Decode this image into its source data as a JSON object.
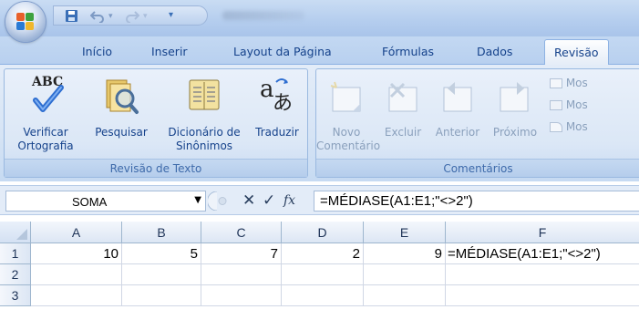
{
  "quick_access": {
    "save_icon": "save-icon",
    "undo_icon": "undo-icon",
    "redo_icon": "redo-icon"
  },
  "tabs": [
    {
      "label": "Início"
    },
    {
      "label": "Inserir"
    },
    {
      "label": "Layout da Página"
    },
    {
      "label": "Fórmulas"
    },
    {
      "label": "Dados"
    },
    {
      "label": "Revisão",
      "active": true
    }
  ],
  "ribbon": {
    "groups": [
      {
        "title": "Revisão de Texto",
        "buttons": [
          {
            "icon": "abc-spellcheck-icon",
            "label": "Verificar Ortografia"
          },
          {
            "icon": "research-book-icon",
            "label": "Pesquisar"
          },
          {
            "icon": "thesaurus-book-icon",
            "label": "Dicionário de Sinônimos"
          },
          {
            "icon": "translate-icon",
            "label": "Traduzir"
          }
        ]
      },
      {
        "title": "Comentários",
        "buttons": [
          {
            "icon": "new-comment-icon",
            "label": "Novo Comentário"
          },
          {
            "icon": "delete-comment-icon",
            "label": "Excluir"
          },
          {
            "icon": "previous-comment-icon",
            "label": "Anterior"
          },
          {
            "icon": "next-comment-icon",
            "label": "Próximo"
          }
        ],
        "small_buttons": [
          "Mos",
          "Mos",
          "Mos"
        ]
      }
    ]
  },
  "formula_bar": {
    "name_box": "SOMA",
    "fx_label": "fx",
    "formula": "=MÉDIASE(A1:E1;\"<>2\")"
  },
  "grid": {
    "columns": [
      "A",
      "B",
      "C",
      "D",
      "E",
      "F"
    ],
    "rows": [
      "1",
      "2",
      "3"
    ],
    "row1": [
      "10",
      "5",
      "7",
      "2",
      "9",
      "=MÉDIASE(A1:E1;\"<>2\")"
    ]
  },
  "colors": {
    "ribbon_text": "#15428b",
    "header_text": "#1f3458",
    "accent": "#3e6aaa"
  }
}
